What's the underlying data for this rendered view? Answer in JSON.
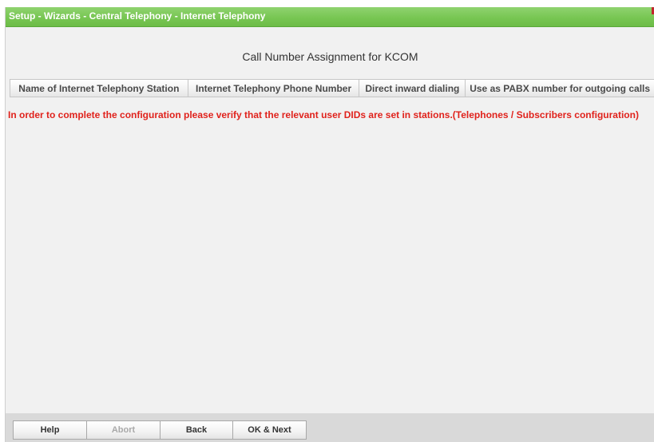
{
  "window": {
    "title": "Setup - Wizards - Central Telephony - Internet Telephony"
  },
  "page": {
    "heading": "Call Number Assignment for KCOM"
  },
  "table": {
    "columns": [
      "Name of Internet Telephony Station",
      "Internet Telephony Phone Number",
      "Direct inward dialing",
      "Use as PABX number for outgoing calls"
    ]
  },
  "notice": {
    "text": "In order to complete the configuration please verify that the relevant user DIDs are set in stations.(Telephones / Subscribers configuration)",
    "color": "#e0221c"
  },
  "footer": {
    "buttons": {
      "help": "Help",
      "abort": "Abort",
      "back": "Back",
      "ok_next": "OK & Next"
    }
  },
  "colors": {
    "titlebar": "#78c653",
    "background": "#f1f1f1",
    "footer": "#d9d9d9"
  }
}
